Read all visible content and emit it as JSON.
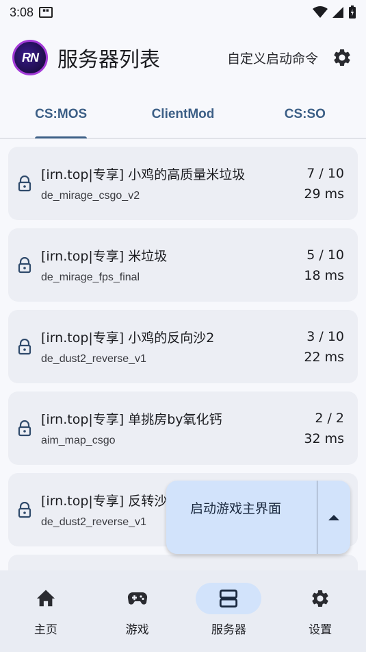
{
  "status_bar": {
    "time": "3:08"
  },
  "header": {
    "logo_text": "RN",
    "title": "服务器列表",
    "custom_command_label": "自定义启动命令"
  },
  "tabs": [
    {
      "label": "CS:MOS",
      "active": true
    },
    {
      "label": "ClientMod",
      "active": false
    },
    {
      "label": "CS:SO",
      "active": false
    }
  ],
  "servers": [
    {
      "name": "[irn.top|专享] 小鸡的高质量米垃圾",
      "map": "de_mirage_csgo_v2",
      "players": "7 / 10",
      "ping": "29 ms"
    },
    {
      "name": "[irn.top|专享] 米垃圾",
      "map": "de_mirage_fps_final",
      "players": "5 / 10",
      "ping": "18 ms"
    },
    {
      "name": "[irn.top|专享] 小鸡的反向沙2",
      "map": "de_dust2_reverse_v1",
      "players": "3 / 10",
      "ping": "22 ms"
    },
    {
      "name": "[irn.top|专享] 单挑房by氧化钙",
      "map": "aim_map_csgo",
      "players": "2 / 2",
      "ping": "32 ms"
    },
    {
      "name": "[irn.top|专享] 反转沙",
      "map": "de_dust2_reverse_v1",
      "players": "",
      "ping": ""
    }
  ],
  "fab": {
    "label": "启动游戏主界面"
  },
  "bottom_nav": [
    {
      "label": "主页",
      "icon": "home-icon",
      "active": false
    },
    {
      "label": "游戏",
      "icon": "gamepad-icon",
      "active": false
    },
    {
      "label": "服务器",
      "icon": "server-icon",
      "active": true
    },
    {
      "label": "设置",
      "icon": "gear-icon",
      "active": false
    }
  ],
  "colors": {
    "accent": "#3c5f86",
    "card_bg": "#eceef4",
    "fab_bg": "#d2e3fb",
    "nav_bg": "#e9ecf3"
  }
}
